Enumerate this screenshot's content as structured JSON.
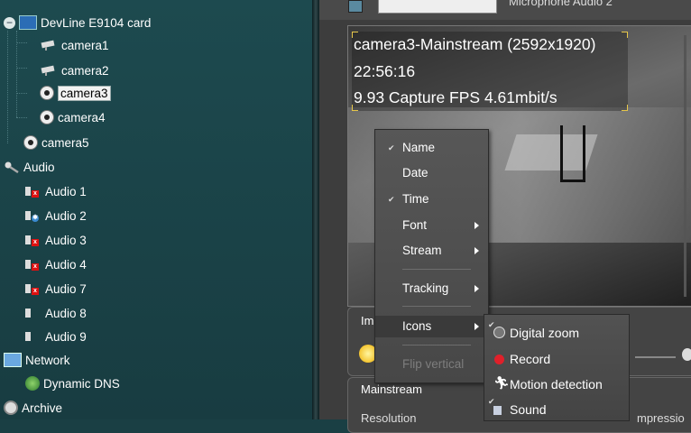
{
  "tree": {
    "root": {
      "label": "DevLine E9104 card",
      "expand_icon": "minus-icon",
      "icon": "capture-card-icon"
    },
    "cameras": [
      {
        "label": "camera1",
        "icon": "security-camera-icon"
      },
      {
        "label": "camera2",
        "icon": "security-camera-icon"
      },
      {
        "label": "camera3",
        "icon": "webcam-icon",
        "selected": true
      },
      {
        "label": "camera4",
        "icon": "webcam-icon"
      }
    ],
    "camera5": {
      "label": "camera5",
      "icon": "webcam-icon"
    },
    "audio_group": {
      "label": "Audio",
      "icon": "microphone-icon"
    },
    "audio_items": [
      {
        "label": "Audio 1",
        "status": "disabled"
      },
      {
        "label": "Audio 2",
        "status": "active"
      },
      {
        "label": "Audio 3",
        "status": "disabled"
      },
      {
        "label": "Audio 4",
        "status": "disabled"
      },
      {
        "label": "Audio 7",
        "status": "disabled"
      },
      {
        "label": "Audio 8",
        "status": "normal"
      },
      {
        "label": "Audio 9",
        "status": "normal"
      }
    ],
    "network": {
      "label": "Network",
      "icon": "monitor-icon"
    },
    "dynamic_dns": {
      "label": "Dynamic DNS",
      "icon": "globe-icon"
    },
    "archive": {
      "label": "Archive",
      "icon": "film-reel-icon"
    }
  },
  "topbar": {
    "text": "Microphone Audio 2"
  },
  "video": {
    "osd_line1": "camera3-Mainstream (2592x1920)",
    "osd_line2": "22:56:16",
    "osd_line3": "9.93 Capture FPS 4.61mbit/s"
  },
  "settings": {
    "image_label": "Im",
    "mainstream_label": "Mainstream",
    "resolution_label": "Resolution",
    "compression_label": "mpressio"
  },
  "context_menu": {
    "items": [
      {
        "label": "Name",
        "checked": true
      },
      {
        "label": "Date",
        "checked": false
      },
      {
        "label": "Time",
        "checked": true
      },
      {
        "label": "Font",
        "submenu": true
      },
      {
        "label": "Stream",
        "submenu": true
      },
      {
        "label": "Tracking",
        "submenu": true
      },
      {
        "label": "Icons",
        "submenu": true,
        "highlighted": true
      },
      {
        "label": "Flip vertical",
        "disabled": true
      }
    ]
  },
  "icons_submenu": {
    "items": [
      {
        "label": "Digital zoom",
        "icon": "zoom-icon",
        "checked": true
      },
      {
        "label": "Record",
        "icon": "record-icon",
        "checked": false
      },
      {
        "label": "Motion detection",
        "icon": "motion-icon",
        "checked": false
      },
      {
        "label": "Sound",
        "icon": "speaker-icon",
        "checked": true
      }
    ]
  },
  "colors": {
    "tree_bg": "#1d4a4f",
    "menu_bg": "#505050",
    "record_red": "#e0202a",
    "osd_corner": "#e6c64a"
  }
}
